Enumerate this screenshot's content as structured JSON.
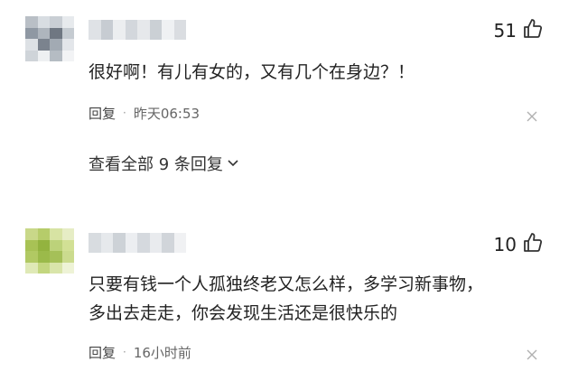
{
  "comments": [
    {
      "likes": "51",
      "text": "很好啊！有儿有女的，又有几个在身边？！",
      "reply_label": "回复",
      "dot": "·",
      "time": "昨天06:53",
      "view_replies": "查看全部 9 条回复"
    },
    {
      "likes": "10",
      "text_line1": "只要有钱一个人孤独终老又怎么样，多学习新事物，",
      "text_line2": "多出去走走，你会发现生活还是很快乐的",
      "reply_label": "回复",
      "dot": "·",
      "time": "16小时前"
    }
  ],
  "icons": {
    "like": "thumbs-up-icon",
    "close": "close-icon",
    "expand": "chevron-down-icon"
  }
}
